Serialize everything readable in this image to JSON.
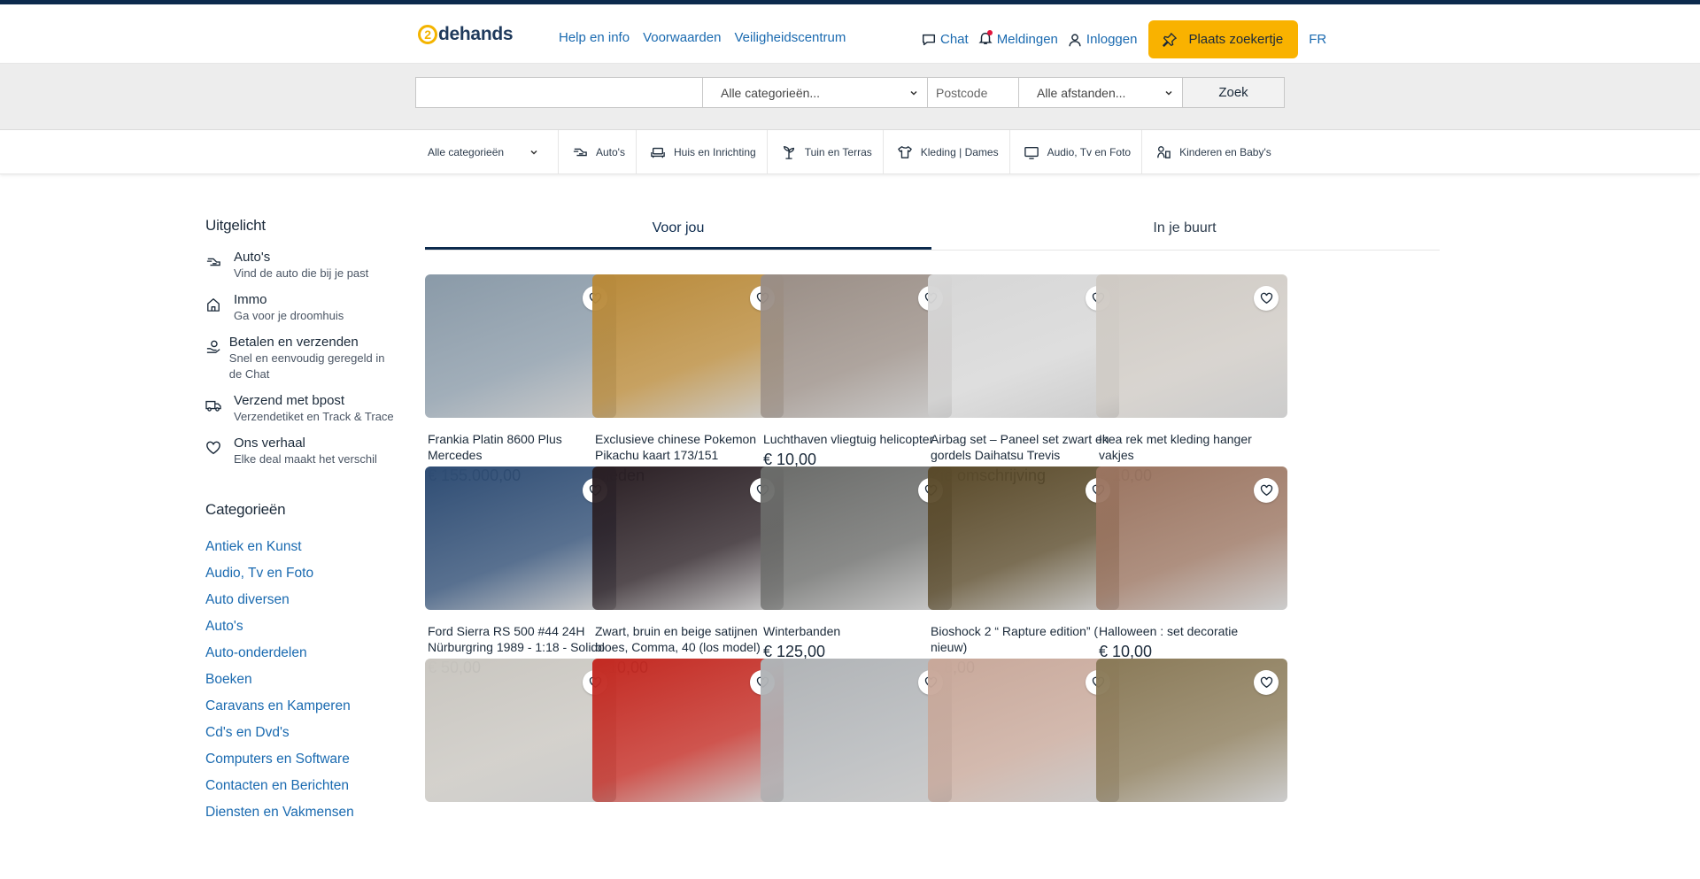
{
  "header": {
    "logo_num": "2",
    "logo_text": "dehands",
    "help_links": [
      "Help en info",
      "Voorwaarden",
      "Veiligheidscentrum"
    ],
    "chat": "Chat",
    "notifications": "Meldingen",
    "login": "Inloggen",
    "place_ad": "Plaats zoekertje",
    "language": "FR"
  },
  "search": {
    "query_value": "",
    "category": "Alle categorieën...",
    "postcode_placeholder": "Postcode",
    "distance": "Alle afstanden...",
    "button": "Zoek"
  },
  "catbar": {
    "all": "Alle categorieën",
    "items": [
      {
        "label": "Auto's",
        "icon": "car-icon"
      },
      {
        "label": "Huis en Inrichting",
        "icon": "sofa-icon"
      },
      {
        "label": "Tuin en Terras",
        "icon": "plant-icon"
      },
      {
        "label": "Kleding | Dames",
        "icon": "clothing-icon"
      },
      {
        "label": "Audio, Tv en Foto",
        "icon": "tv-icon"
      },
      {
        "label": "Kinderen en Baby's",
        "icon": "baby-icon"
      }
    ]
  },
  "sidebar": {
    "featured_title": "Uitgelicht",
    "featured": [
      {
        "title": "Auto's",
        "sub": "Vind de auto die bij je past",
        "icon": "car-icon"
      },
      {
        "title": "Immo",
        "sub": "Ga voor je droomhuis",
        "icon": "house-icon"
      },
      {
        "title": "Betalen en verzenden",
        "sub": "Snel en eenvoudig geregeld in de Chat",
        "icon": "payment-hand-icon"
      },
      {
        "title": "Verzend met bpost",
        "sub": "Verzendetiket en Track & Trace",
        "icon": "truck-icon"
      },
      {
        "title": "Ons verhaal",
        "sub": "Elke deal maakt het verschil",
        "icon": "heart-icon"
      }
    ],
    "categories_title": "Categorieën",
    "categories": [
      "Antiek en Kunst",
      "Audio, Tv en Foto",
      "Auto diversen",
      "Auto's",
      "Auto-onderdelen",
      "Boeken",
      "Caravans en Kamperen",
      "Cd's en Dvd's",
      "Computers en Software",
      "Contacten en Berichten",
      "Diensten en Vakmensen"
    ]
  },
  "tabs": [
    "Voor jou",
    "In je buurt"
  ],
  "listings": [
    {
      "title": "Frankia Platin 8600 Plus Mercedes",
      "price": "€ 155.000,00",
      "bg": "#8a9aa8"
    },
    {
      "title": "Exclusieve chinese Pokemon Pikachu kaart 173/151",
      "price": "Bieden",
      "bg": "#b98a3a"
    },
    {
      "title": "Luchthaven vliegtuig helicopter",
      "price": "€ 10,00",
      "bg": "#9a8e86"
    },
    {
      "title": "Airbag set – Paneel set zwart en gordels Daihatsu Trevis",
      "price": "Zie omschrijving",
      "bg": "#d6d6d6"
    },
    {
      "title": "Ikea rek met kleding hanger vakjes",
      "price": "€ 10,00",
      "bg": "#cfcac4"
    },
    {
      "title": "Ford Sierra RS 500 #44 24H Nürburgring 1989 - 1:18 - Solido",
      "price": "€ 50,00",
      "bg": "#2f4d74"
    },
    {
      "title": "Zwart, bruin en beige satijnen bloes, Comma, 40 (los model)",
      "price": "€ 10,00",
      "bg": "#2a1f24"
    },
    {
      "title": "Winterbanden",
      "price": "€ 125,00",
      "bg": "#6b6c6a"
    },
    {
      "title": "Bioshock 2 “ Rapture edition” ( nieuw)",
      "price": "€ 8,00",
      "bg": "#5a4a2a"
    },
    {
      "title": "Halloween : set decoratie",
      "price": "€ 10,00",
      "bg": "#9a7460"
    },
    {
      "title": "",
      "price": "",
      "bg": "#c9c6c0"
    },
    {
      "title": "",
      "price": "",
      "bg": "#c32a22"
    },
    {
      "title": "",
      "price": "",
      "bg": "#b0b3b6"
    },
    {
      "title": "",
      "price": "",
      "bg": "#c8a89a"
    },
    {
      "title": "",
      "price": "",
      "bg": "#8a7a58"
    }
  ]
}
